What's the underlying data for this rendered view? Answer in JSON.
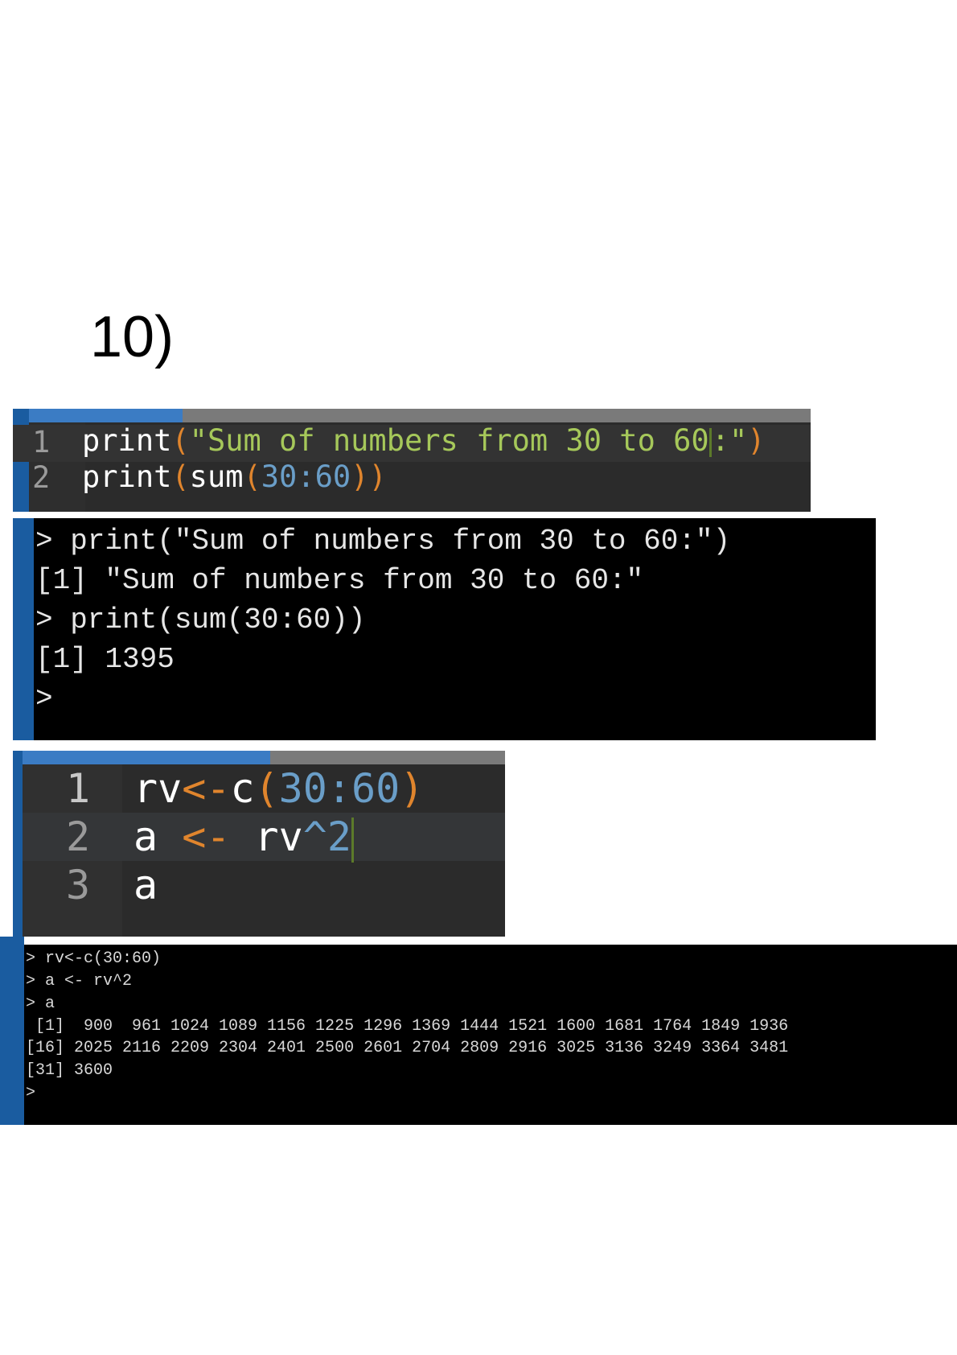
{
  "heading": "10)",
  "editor1": {
    "lines": [
      {
        "number": "1",
        "fn": "print",
        "open": "(",
        "string": "\"Sum of numbers from 30 to 60",
        "string_end": ":\"",
        "close": ")"
      },
      {
        "number": "2",
        "fn1": "print",
        "open1": "(",
        "fn2": "sum",
        "open2": "(",
        "num1": "30",
        "colon": ":",
        "num2": "60",
        "close": "))"
      }
    ]
  },
  "console1": {
    "lines": [
      "> print(\"Sum of numbers from 30 to 60:\")",
      "[1] \"Sum of numbers from 30 to 60:\"",
      "> print(sum(30:60))",
      "[1] 1395",
      ">"
    ]
  },
  "editor2": {
    "lines": [
      {
        "number": "1",
        "a": "rv",
        "op": "<-",
        "b": "c",
        "open": "(",
        "num1": "30",
        "colon": ":",
        "num2": "60",
        "close": ")"
      },
      {
        "number": "2",
        "a": "a ",
        "op": "<-",
        "b": " rv",
        "caret": "^",
        "num": "2"
      },
      {
        "number": "3",
        "a": "a"
      }
    ]
  },
  "console2": {
    "lines": [
      "> rv<-c(30:60)",
      "> a <- rv^2",
      "> a",
      " [1]  900  961 1024 1089 1156 1225 1296 1369 1444 1521 1600 1681 1764 1849 1936",
      "[16] 2025 2116 2209 2304 2401 2500 2601 2704 2809 2916 3025 3136 3249 3364 3481",
      "[31] 3600",
      ">"
    ]
  },
  "colors": {
    "accent": "#3b7cc4",
    "string": "#a6c85a",
    "paren": "#e0852d",
    "number": "#6a9ec8",
    "editor_bg": "#2b2b2b",
    "console_bg": "#000000"
  }
}
